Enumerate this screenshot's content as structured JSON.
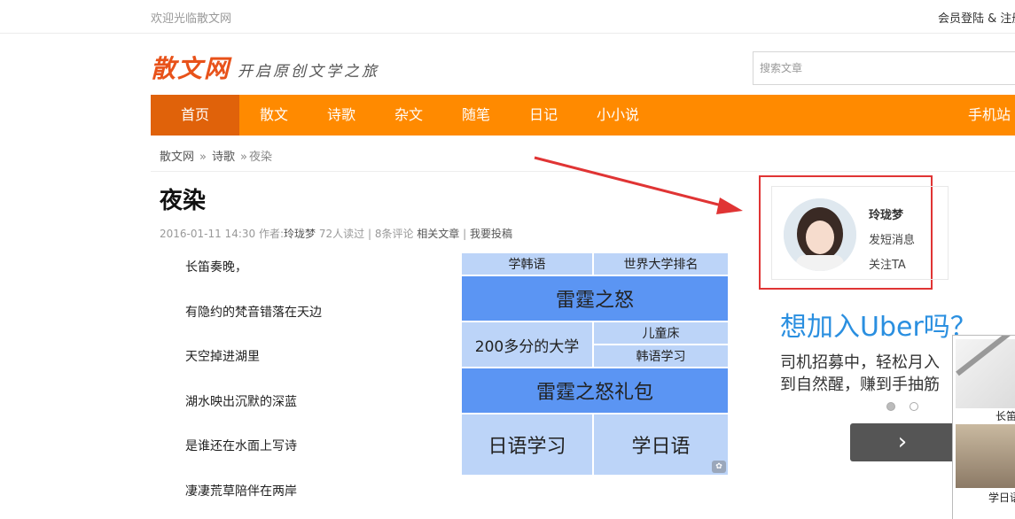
{
  "topbar": {
    "welcome": "欢迎光临散文网",
    "login": "会员登陆 & 注册"
  },
  "logo": {
    "brand": "散文网",
    "slogan": "开启原创文学之旅"
  },
  "search": {
    "placeholder": "搜索文章"
  },
  "nav": {
    "items": [
      "首页",
      "散文",
      "诗歌",
      "杂文",
      "随笔",
      "日记",
      "小小说"
    ],
    "mobile": "手机站"
  },
  "breadcrumb": {
    "home": "散文网",
    "sep1": "»",
    "category": "诗歌",
    "sep2": "»",
    "current": "夜染"
  },
  "article": {
    "title": "夜染",
    "date": "2016-01-11 14:30",
    "author_label": "作者:",
    "author": "玲珑梦",
    "reads": "72人读过",
    "comments": "8条评论",
    "related": "相关文章",
    "submit": "我要投稿",
    "lines": [
      "长笛奏晚，",
      "有隐约的梵音错落在天边",
      "天空掉进湖里",
      "湖水映出沉默的深蓝",
      "是谁还在水面上写诗",
      "凄凄荒草陪伴在两岸"
    ]
  },
  "ad_grid": {
    "r1a": "学韩语",
    "r1b": "世界大学排名",
    "r2": "雷霆之怒",
    "r3a": "200多分的大学",
    "r3b": "儿童床",
    "r3c": "韩语学习",
    "r4": "雷霆之怒礼包",
    "r5a": "日语学习",
    "r5b": "学日语"
  },
  "author_card": {
    "name": "玲珑梦",
    "message": "发短消息",
    "follow": "关注TA"
  },
  "uber_ad": {
    "title": "想加入Uber吗？",
    "line1": "司机招募中，轻松月入",
    "line2": "到自然醒，赚到手抽筋",
    "next": "›"
  },
  "side_ad": {
    "cap1": "长笛",
    "cap2": "学日语"
  },
  "colors": {
    "nav": "#ff8a00",
    "nav_active": "#e0620a",
    "brand": "#e8521a",
    "highlight": "#e03434",
    "uber": "#2a8fe0"
  }
}
